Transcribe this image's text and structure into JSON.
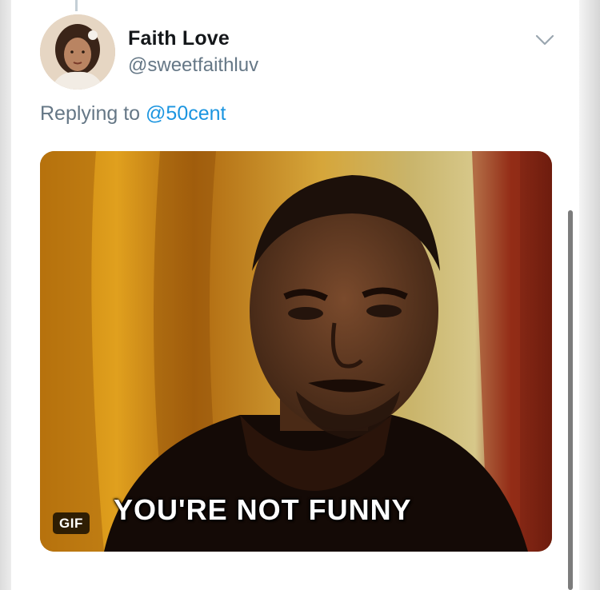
{
  "tweet": {
    "display_name": "Faith Love",
    "handle": "@sweetfaithluv",
    "reply_prefix": "Replying to",
    "reply_mention": "@50cent"
  },
  "media": {
    "caption": "YOU'RE NOT FUNNY",
    "badge": "GIF"
  },
  "icons": {
    "menu": "chevron-down-icon"
  },
  "colors": {
    "name_text": "#14171a",
    "secondary_text": "#657786",
    "mention": "#1b95e0"
  }
}
